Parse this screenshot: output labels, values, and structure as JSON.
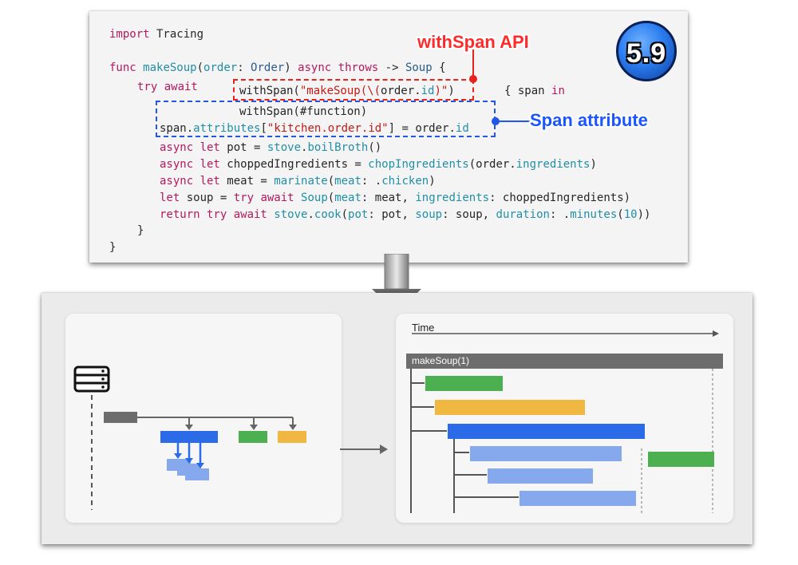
{
  "code": {
    "lines": [
      "import Tracing",
      "func makeSoup(order: Order) async throws -> Soup {",
      "try await",
      "withSpan(\"makeSoup(\\(order.id)\")",
      "{ span in",
      "withSpan(#function)",
      "span.attributes[\"kitchen.order.id\"] = order.id",
      "async let pot = stove.boilBroth()",
      "async let choppedIngredients = chopIngredients(order.ingredients)",
      "async let meat = marinate(meat: .chicken)",
      "let soup = try await Soup(meat: meat, ingredients: choppedIngredients)",
      "return try await stove.cook(pot: pot, soup: soup, duration: .minutes(10))",
      "}",
      "}"
    ]
  },
  "annotations": {
    "with_span_api": "withSpan API",
    "span_attribute": "Span attribute"
  },
  "badge": {
    "version": "5.9"
  },
  "timeline": {
    "axis_label": "Time",
    "root_span": "makeSoup(1)"
  },
  "colors": {
    "red": "#e8231e",
    "blue": "#2256e8",
    "span_green": "#4caf50",
    "span_yellow": "#f0b840",
    "span_blue": "#2b6be8",
    "span_light_blue": "#86a8ec",
    "span_gray": "#6d6d6d"
  },
  "icons": {
    "server": "server-icon",
    "arrow": "down-arrow-icon"
  }
}
